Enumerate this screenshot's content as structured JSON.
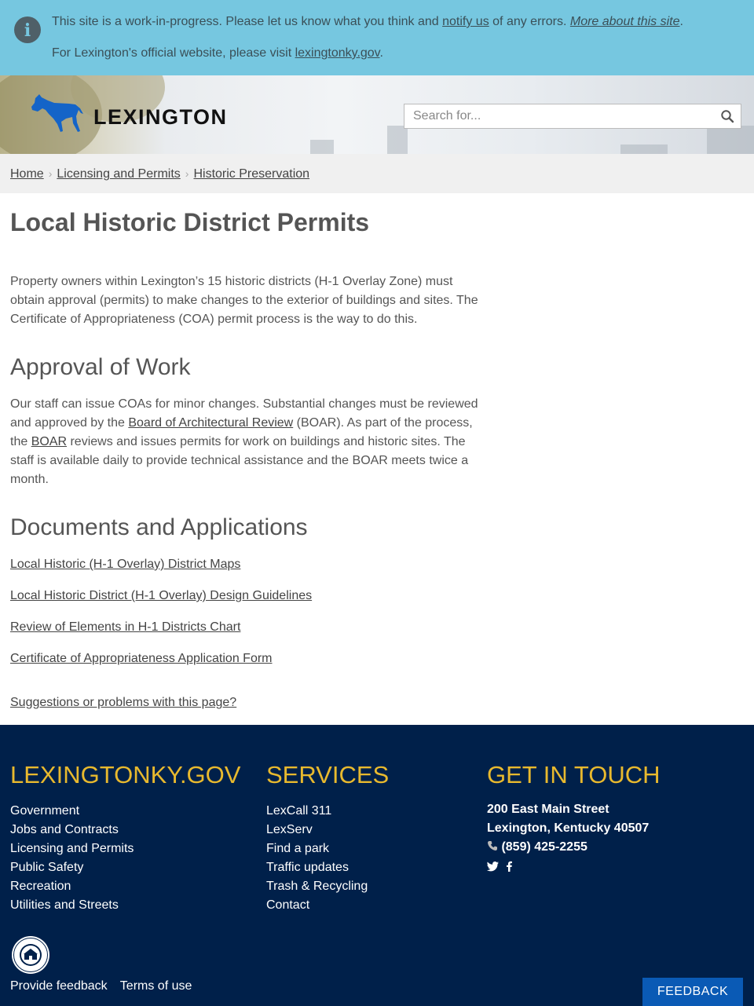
{
  "alert": {
    "text_1": "This site is a work-in-progress. Please let us know what you think and ",
    "link_notify": "notify us",
    "text_2": " of any errors. ",
    "link_more": "More about this site",
    "text_3": ".",
    "line2_text": "For Lexington's official website, please visit ",
    "line2_link": "lexingtonky.gov",
    "line2_end": "."
  },
  "header": {
    "logo_text": "LEXINGTON",
    "search_placeholder": "Search for...",
    "horse_color": "#1464c8"
  },
  "breadcrumb": [
    "Home",
    "Licensing and Permits",
    "Historic Preservation"
  ],
  "main": {
    "title": "Local Historic District Permits",
    "intro": "Property owners within Lexington’s 15 historic districts (H-1 Overlay Zone) must obtain approval (permits) to make changes to the exterior of buildings and sites. The Certificate of Appropriateness (COA) permit process is the way to do this.",
    "approval_heading": "Approval of Work",
    "approval_1": "Our staff can issue COAs for minor changes. Substantial changes must be reviewed and approved by the ",
    "approval_link_1": "Board of Architectural Review",
    "approval_2": " (BOAR). As part of the process, the ",
    "approval_link_2": "BOAR",
    "approval_3": " reviews and issues permits for work on buildings and historic sites. The staff is available daily to provide technical assistance and the BOAR meets twice a month.",
    "docs_heading": "Documents and Applications",
    "docs": [
      "Local Historic (H-1 Overlay) District Maps",
      "Local Historic District (H-1 Overlay) Design Guidelines",
      "Review of Elements in H-1 Districts Chart",
      "Certificate of Appropriateness Application Form"
    ],
    "suggestions": "Suggestions or problems with this page?"
  },
  "footer": {
    "col1_heading": "LEXINGTONKY.GOV",
    "col1_items": [
      "Government",
      "Jobs and Contracts",
      "Licensing and Permits",
      "Public Safety",
      "Recreation",
      "Utilities and Streets"
    ],
    "col2_heading": "SERVICES",
    "col2_items": [
      "LexCall 311",
      "LexServ",
      "Find a park",
      "Traffic updates",
      "Trash & Recycling",
      "Contact"
    ],
    "col3_heading": "GET IN TOUCH",
    "address_1": "200 East Main Street",
    "address_2": "Lexington, Kentucky 40507",
    "phone": "(859) 425-2255",
    "bottom_links": [
      "Provide feedback",
      "Terms of use"
    ],
    "feedback_button": "FEEDBACK",
    "heading_color": "#e8b92e",
    "background_color": "#00204a"
  }
}
